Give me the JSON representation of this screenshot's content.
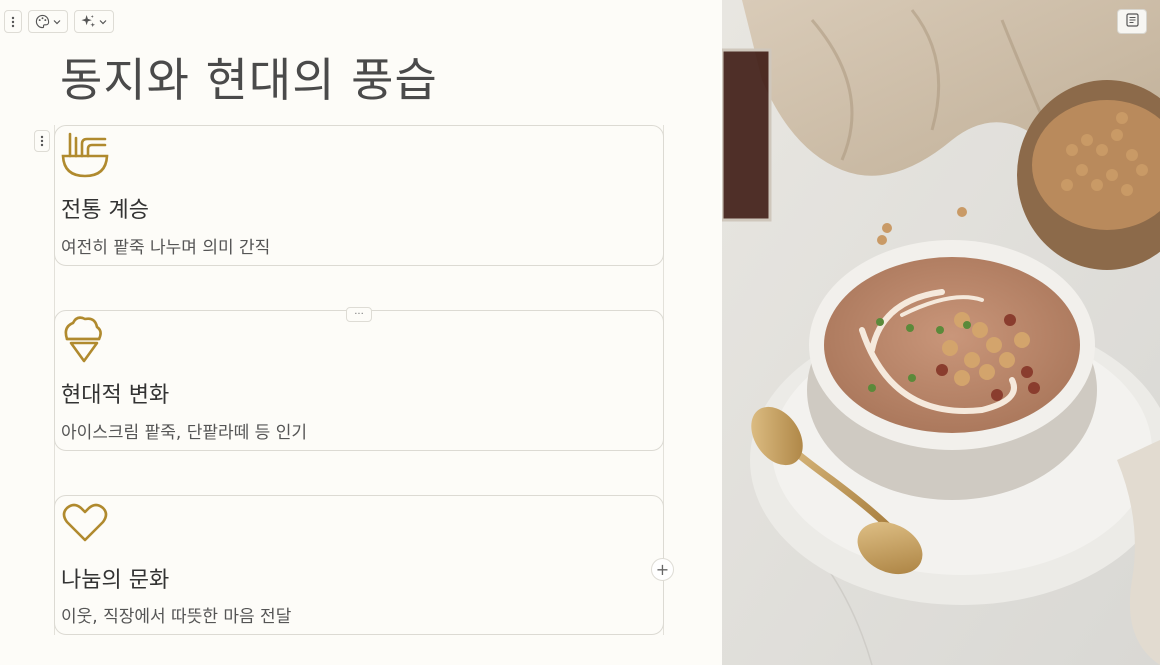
{
  "title": "동지와 현대의 풍습",
  "toolbar": {
    "handle_icon": "vertical-dots-icon",
    "theme_icon": "palette-icon",
    "ai_icon": "sparkle-icon"
  },
  "cards": [
    {
      "icon": "noodle-bowl-icon",
      "title": "전통 계승",
      "description": "여전히 팥죽 나누며 의미 간직"
    },
    {
      "icon": "ice-cream-icon",
      "title": "현대적 변화",
      "description": "아이스크림 팥죽, 단팥라떼 등 인기"
    },
    {
      "icon": "heart-icon",
      "title": "나눔의 문화",
      "description": "이웃, 직장에서 따뜻한 마음 전달"
    }
  ],
  "controls": {
    "more_label": "···",
    "add_label": "+"
  },
  "image": {
    "subject": "red-bean-porridge-bowl-photo",
    "notes_icon": "notes-icon"
  },
  "colors": {
    "background": "#fdfcf8",
    "icon_gold": "#b08a2e",
    "border": "#dcdad3"
  }
}
